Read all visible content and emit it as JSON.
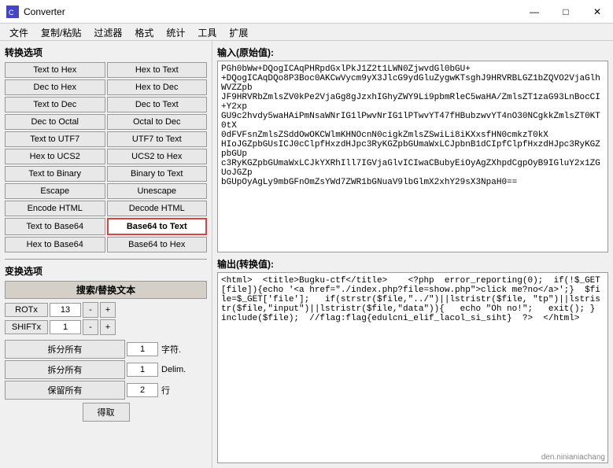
{
  "window": {
    "title": "Converter",
    "icon": "C"
  },
  "titlebar_controls": {
    "minimize": "—",
    "maximize": "□",
    "close": "✕"
  },
  "menu": {
    "items": [
      "文件",
      "复制/粘贴",
      "过滤器",
      "格式",
      "统计",
      "工具",
      "扩展"
    ]
  },
  "left": {
    "section1_title": "转换选项",
    "buttons": [
      {
        "label": "Text to Hex",
        "col": 0,
        "active": false
      },
      {
        "label": "Hex to Text",
        "col": 1,
        "active": false
      },
      {
        "label": "Dec to Hex",
        "col": 0,
        "active": false
      },
      {
        "label": "Hex to Dec",
        "col": 1,
        "active": false
      },
      {
        "label": "Text to Dec",
        "col": 0,
        "active": false
      },
      {
        "label": "Dec to Text",
        "col": 1,
        "active": false
      },
      {
        "label": "Dec to Octal",
        "col": 0,
        "active": false
      },
      {
        "label": "Octal to Dec",
        "col": 1,
        "active": false
      },
      {
        "label": "Text to UTF7",
        "col": 0,
        "active": false
      },
      {
        "label": "UTF7 to Text",
        "col": 1,
        "active": false
      },
      {
        "label": "Hex to UCS2",
        "col": 0,
        "active": false
      },
      {
        "label": "UCS2 to Hex",
        "col": 1,
        "active": false
      },
      {
        "label": "Text to Binary",
        "col": 0,
        "active": false
      },
      {
        "label": "Binary to Text",
        "col": 1,
        "active": false
      },
      {
        "label": "Escape",
        "col": 0,
        "active": false
      },
      {
        "label": "Unescape",
        "col": 1,
        "active": false
      },
      {
        "label": "Encode HTML",
        "col": 0,
        "active": false
      },
      {
        "label": "Decode HTML",
        "col": 1,
        "active": false
      },
      {
        "label": "Text to Base64",
        "col": 0,
        "active": false
      },
      {
        "label": "Base64 to Text",
        "col": 1,
        "active": true
      },
      {
        "label": "Hex to Base64",
        "col": 0,
        "active": false
      },
      {
        "label": "Base64 to Hex",
        "col": 1,
        "active": false
      }
    ],
    "section2_title": "变换选项",
    "search_label": "搜索/替换文本",
    "rot_rows": [
      {
        "label": "ROTx",
        "value": "13"
      },
      {
        "label": "SHIFTx",
        "value": "1"
      }
    ],
    "minus": "-",
    "plus": "+",
    "split_rows": [
      {
        "label": "拆分所有",
        "value": "1",
        "unit": "字符."
      },
      {
        "label": "拆分所有",
        "value": "1",
        "unit": "Delim."
      },
      {
        "label": "保留所有",
        "value": "2",
        "unit": "行"
      }
    ],
    "get_label": "得取"
  },
  "right": {
    "input_label": "输入(原始值):",
    "input_text": "PGh0bWw+DQogICAqPHRpdGxlPkJ1Z2t1LWN0ZjwvdGl0bGU+\r\n+DQogICAqDQo8P3Boc0AKCwVycm9yX3JlcG9ydGluZygwKTsghJ9HRVRBLGZ1bZQVO2VjaGlhWVZZpb\r\nJF9HRVRbZmlsZV0kPe2VjaGg8gJzxhIGhyZWY9Li9pbmRleC5waHA/ZmlsZT1zaG93LnBocCI+Y2xp\r\nGU9c2hvdy5waHAiPmNsaWNrIG1lPwvNrIG1lPTwvYT47fHBubzwvYT4nO30NCgkkZmlsZT0KT0tX\r\n0dFVFsnZmlsZSddOwOKCWlmKHNOcnN0cigkZmlsZSwiLi8iKXxsfHN0cmkzT0kX\r\nHIoJGZpbGUsICJ0cClpfHxzdHJpc3RyKGZpbGUmaWxLCJpbnB1dCIpfClpfHxzdHJpc3RyKGZpbGUp\r\nc3RyKGZpbGUmaWxLCJkYXRhIll7IGVjaGlvICIwaCBubyEiOyAgZXhpdCgpOyB9IGluY2x1ZGUoJGZp\r\nbGUpOyAgLy9mbGFnOmZsYWd7ZWR1bGNuaV9lbGlmX2xhY29sX3NpaH0==",
    "output_label": "输出(转换值):",
    "output_text": "<html>  <title>Bugku-ctf</title>    <?php  error_reporting(0);  if(!$_GET[file]){echo '<a href=\"./index.php?file=show.php\">click me?no</a>';}  $file=$_GET['file'];   if(strstr($file,\"../\")||lstristr($file, \"tp\")||lstristr($file,\"input\")||lstristr($file,\"data\")){   echo \"Oh no!\";   exit(); }  include($file);  //flag:flag{edulcni_elif_lacol_si_siht}  ?>  </html>",
    "watermark": "den.ninianiachang"
  }
}
